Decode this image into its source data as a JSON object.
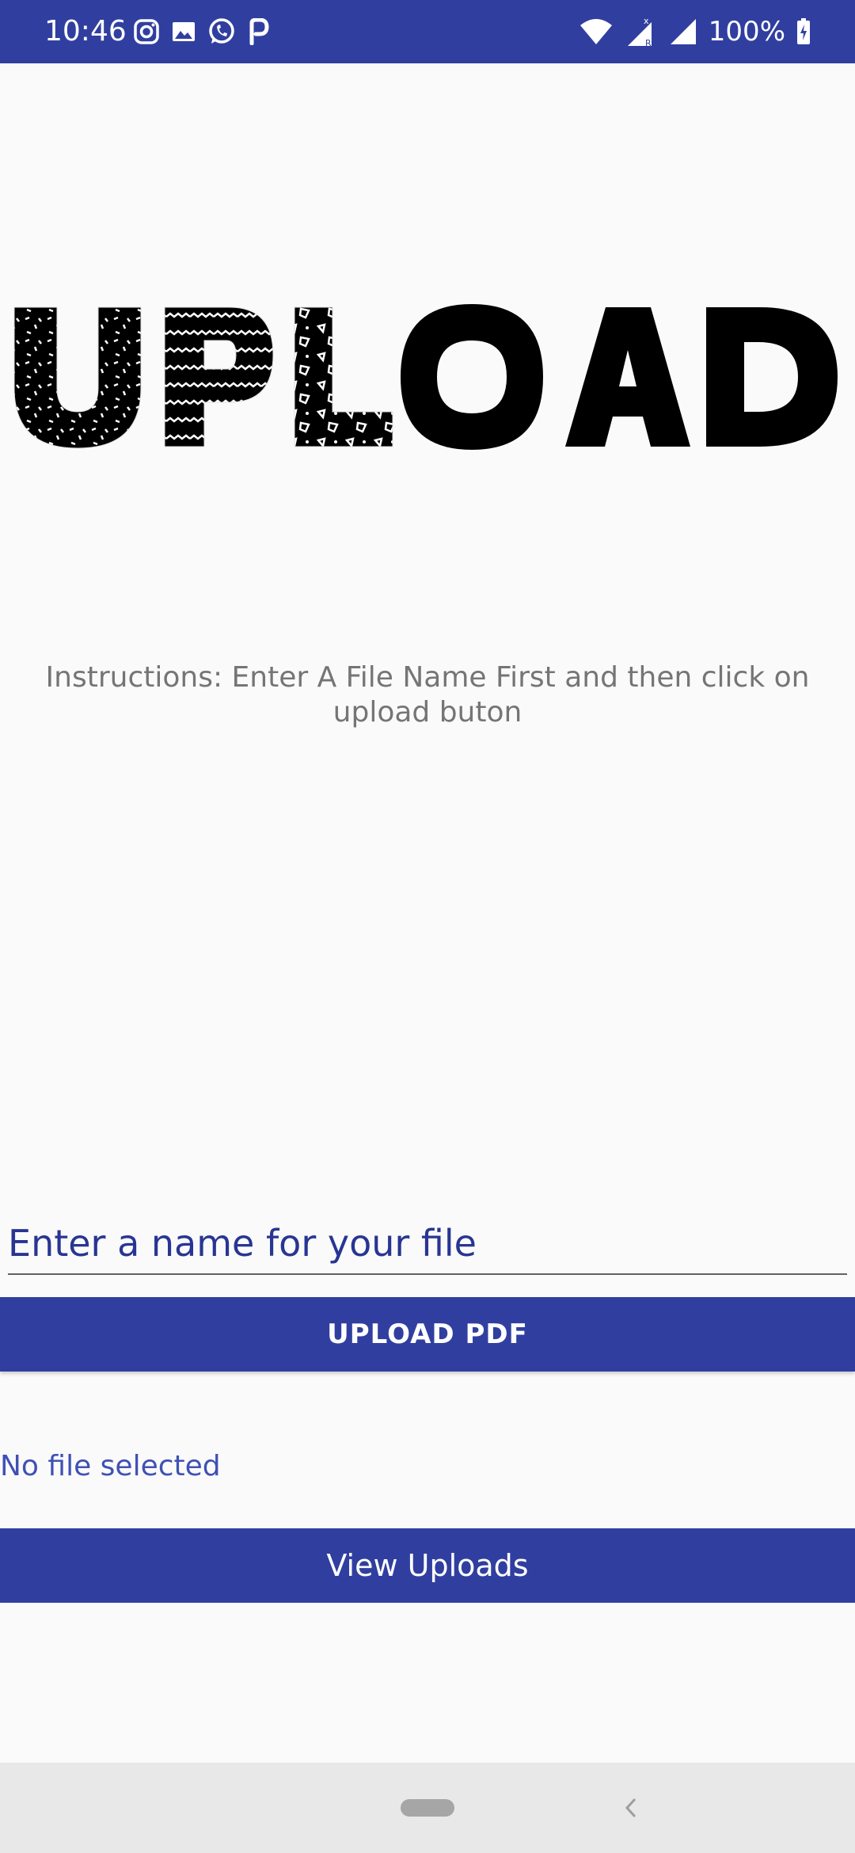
{
  "status_bar": {
    "time": "10:46",
    "battery": "100%",
    "left_icons": [
      "instagram-icon",
      "gallery-icon",
      "whatsapp-icon",
      "p-icon"
    ],
    "right_icons": [
      "wifi-icon",
      "signal-r-icon",
      "signal-icon",
      "battery-icon"
    ],
    "color": "#303f9f"
  },
  "hero": {
    "text": "UPLOAD"
  },
  "instructions": {
    "text": "Instructions: Enter A File Name First and then click on upload buton"
  },
  "file_name_input": {
    "value": "",
    "placeholder": "Enter a name for your file"
  },
  "upload_button": {
    "label": "UPLOAD PDF"
  },
  "file_status": {
    "text": "No file selected"
  },
  "view_uploads_button": {
    "label": "View Uploads"
  },
  "colors": {
    "primary": "#303f9f",
    "background": "#fafafa",
    "link": "#3f51b5",
    "hint": "#757575"
  }
}
